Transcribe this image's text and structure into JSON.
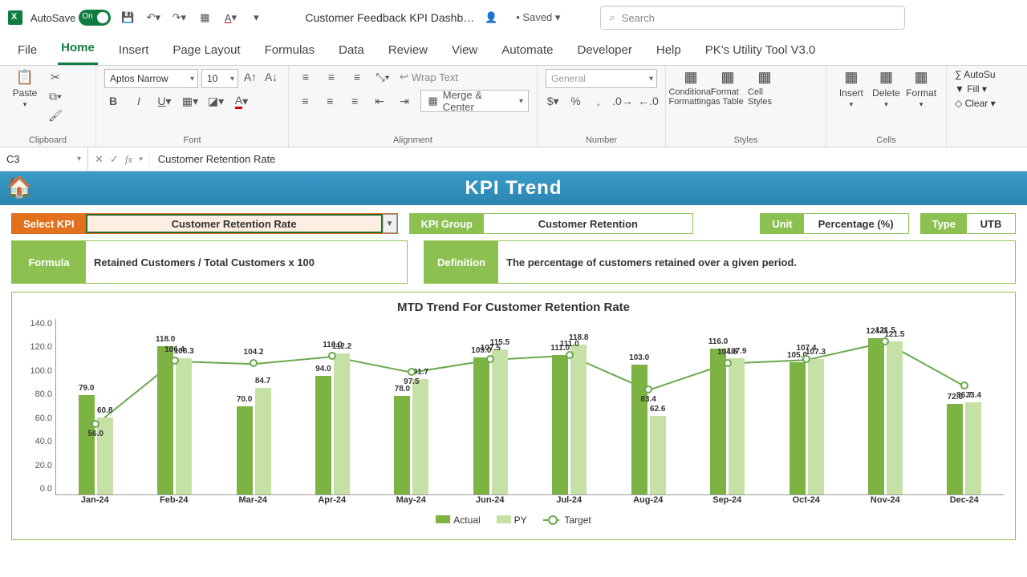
{
  "titlebar": {
    "autosave_label": "AutoSave",
    "autosave_state": "On",
    "doc_title": "Customer Feedback KPI Dashb…",
    "saved_state": "• Saved",
    "search_placeholder": "Search"
  },
  "ribbon_tabs": [
    "File",
    "Home",
    "Insert",
    "Page Layout",
    "Formulas",
    "Data",
    "Review",
    "View",
    "Automate",
    "Developer",
    "Help",
    "PK's Utility Tool V3.0"
  ],
  "active_tab": "Home",
  "ribbon": {
    "clipboard": {
      "paste": "Paste",
      "label": "Clipboard"
    },
    "font": {
      "name": "Aptos Narrow",
      "size": "10",
      "label": "Font"
    },
    "alignment": {
      "wrap": "Wrap Text",
      "merge": "Merge & Center",
      "label": "Alignment"
    },
    "number": {
      "format": "General",
      "label": "Number"
    },
    "styles": {
      "cond": "Conditional Formatting",
      "table": "Format as Table",
      "cell": "Cell Styles",
      "label": "Styles"
    },
    "cells": {
      "insert": "Insert",
      "delete": "Delete",
      "format": "Format",
      "label": "Cells"
    },
    "editing": {
      "autosum": "AutoSu",
      "fill": "Fill",
      "clear": "Clear"
    }
  },
  "formula_bar": {
    "cell": "C3",
    "value": "Customer Retention Rate"
  },
  "dashboard": {
    "title": "KPI Trend",
    "select_kpi_label": "Select KPI",
    "select_kpi_value": "Customer Retention Rate",
    "group_label": "KPI Group",
    "group_value": "Customer Retention",
    "unit_label": "Unit",
    "unit_value": "Percentage (%)",
    "type_label": "Type",
    "type_value": "UTB",
    "formula_label": "Formula",
    "formula_value": "Retained Customers / Total Customers x 100",
    "definition_label": "Definition",
    "definition_value": "The percentage of customers retained over a given period.",
    "chart_title": "MTD Trend For Customer Retention Rate",
    "legend": {
      "actual": "Actual",
      "py": "PY",
      "target": "Target"
    }
  },
  "chart_data": {
    "type": "bar",
    "title": "MTD Trend For Customer Retention Rate",
    "xlabel": "",
    "ylabel": "",
    "ylim": [
      0,
      140
    ],
    "yticks": [
      0,
      20,
      40,
      60,
      80,
      100,
      120,
      140
    ],
    "categories": [
      "Jan-24",
      "Feb-24",
      "Mar-24",
      "Apr-24",
      "May-24",
      "Jun-24",
      "Jul-24",
      "Aug-24",
      "Sep-24",
      "Oct-24",
      "Nov-24",
      "Dec-24"
    ],
    "series": [
      {
        "name": "Actual",
        "values": [
          79.0,
          118.0,
          70.0,
          94.0,
          78.0,
          109.0,
          111.0,
          103.0,
          116.0,
          105.0,
          124.0,
          72.0
        ]
      },
      {
        "name": "PY",
        "values": [
          60.8,
          108.3,
          84.7,
          112.2,
          91.7,
          115.5,
          118.8,
          62.6,
          107.9,
          107.3,
          121.5,
          73.4
        ]
      },
      {
        "name": "Target",
        "values": [
          56.0,
          106.4,
          104.2,
          110.0,
          97.5,
          107.5,
          111.0,
          83.4,
          104.6,
          107.4,
          121.5,
          86.7
        ]
      }
    ],
    "legend_position": "bottom"
  }
}
